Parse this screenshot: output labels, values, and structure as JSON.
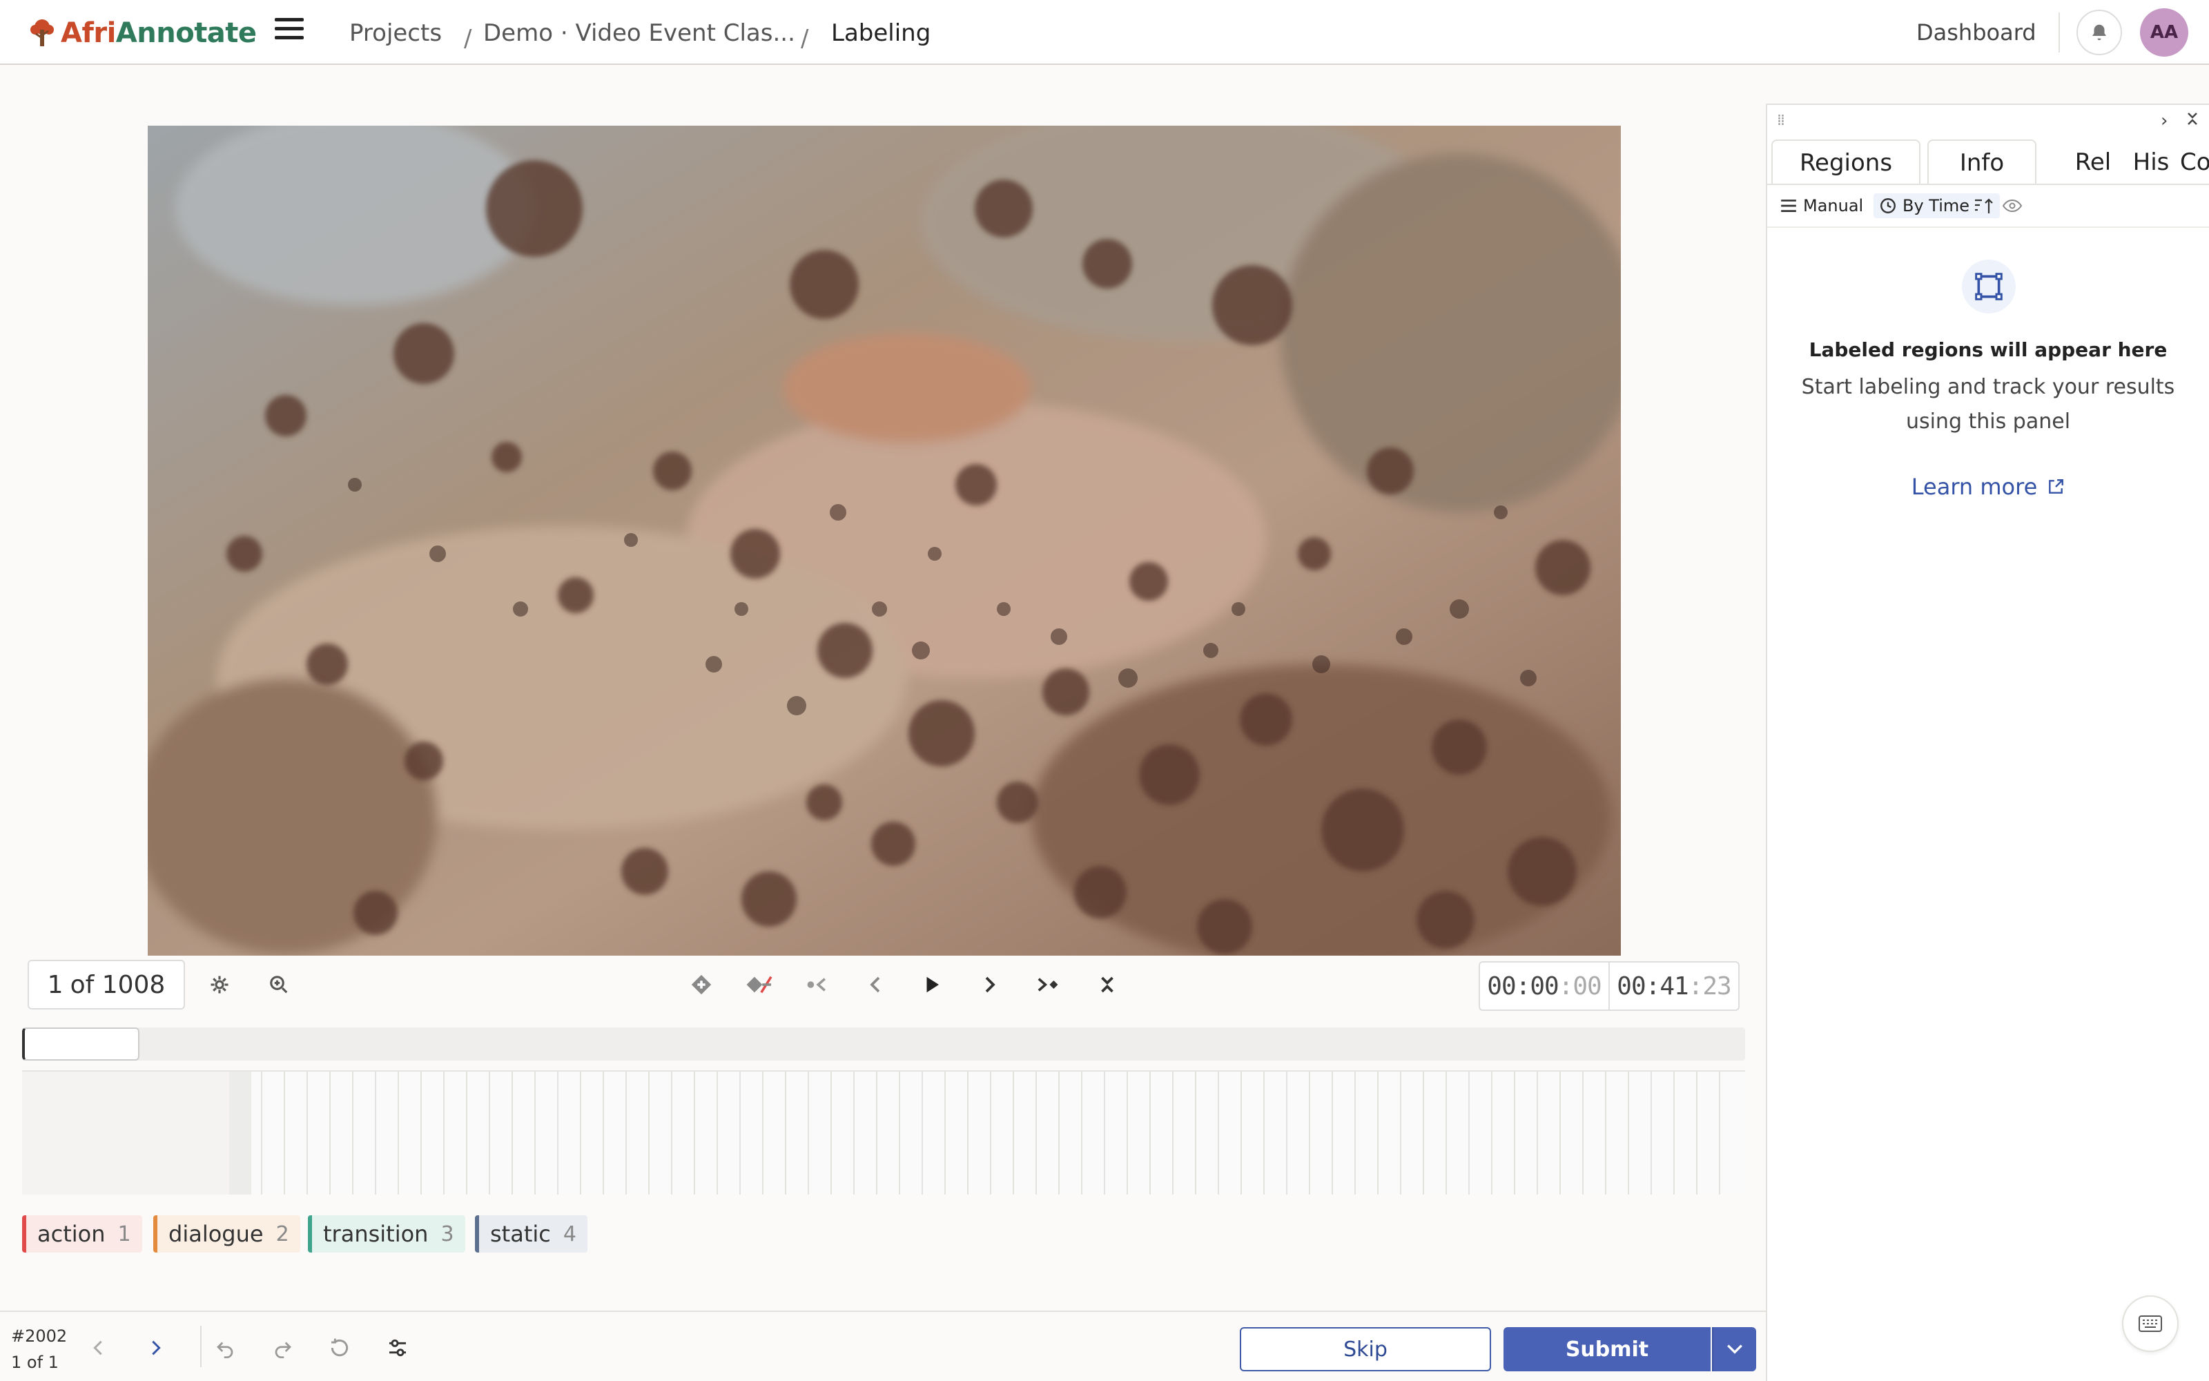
{
  "header": {
    "logo_text_prefix": "Afri",
    "logo_text_suffix": "Annotate",
    "breadcrumbs": [
      "Projects",
      "Demo · Video Event Clas...",
      "Labeling"
    ],
    "separator": "/",
    "dashboard_label": "Dashboard",
    "avatar_initials": "AA"
  },
  "player": {
    "frame_current": "1",
    "frame_of": "of 1008",
    "time_current_main": "00:00",
    "time_current_frac": ":00",
    "time_total_main": "00:41",
    "time_total_frac": ":23",
    "progress": 0.0
  },
  "labels": [
    {
      "name": "action",
      "key": "1",
      "color": "#e14a4a",
      "bg": "#fbe9e8"
    },
    {
      "name": "dialogue",
      "key": "2",
      "color": "#e48a3c",
      "bg": "#fbeee3"
    },
    {
      "name": "transition",
      "key": "3",
      "color": "#3ea58c",
      "bg": "#e5f3ee"
    },
    {
      "name": "static",
      "key": "4",
      "color": "#5c6f8f",
      "bg": "#e9ecf1"
    }
  ],
  "task": {
    "id": "#2002",
    "position": "1 of 1"
  },
  "actions": {
    "skip_label": "Skip",
    "submit_label": "Submit"
  },
  "panel": {
    "tabs": [
      "Regions",
      "Info",
      "Rel",
      "His",
      "Co"
    ],
    "sort_manual": "Manual",
    "sort_by_time": "By Time",
    "empty_title": "Labeled regions will appear here",
    "empty_desc": "Start labeling and track your results using this panel",
    "learn_more": "Learn more"
  },
  "colors": {
    "accent": "#4a62b5",
    "link": "#3553a6",
    "logo_orange": "#c94a28",
    "logo_green": "#2f7a5a"
  }
}
